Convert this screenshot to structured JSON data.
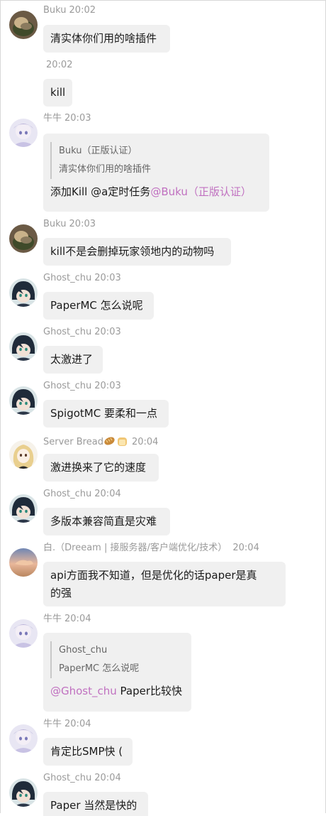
{
  "messages": [
    {
      "name": "Buku",
      "time": "20:02",
      "text": "清实体你们用的啥插件"
    },
    {
      "name": "",
      "time": "20:02",
      "text": "kill"
    },
    {
      "name": "牛牛",
      "time": "20:03",
      "quote_name": "Buku（正版认证）",
      "quote_text": "清实体你们用的啥插件",
      "text": "添加Kill @a定时任务",
      "mention": "@Buku（正版认证）"
    },
    {
      "name": "Buku",
      "time": "20:03",
      "text": "kill不是会删掉玩家领地内的动物吗"
    },
    {
      "name": "Ghost_chu",
      "time": "20:03",
      "text": "PaperMC 怎么说呢"
    },
    {
      "name": "Ghost_chu",
      "time": "20:03",
      "text": "太激进了"
    },
    {
      "name": "Ghost_chu",
      "time": "20:03",
      "text": "SpigotMC 要柔和一点"
    },
    {
      "name": "Server Bread",
      "time": "20:04",
      "text": "激进换来了它的速度",
      "emojis": [
        "bread-emoji",
        "bread-loaf-emoji"
      ]
    },
    {
      "name": "Ghost_chu",
      "time": "20:04",
      "text": "多版本兼容简直是灾难"
    },
    {
      "name": "白.（Dreeam | 接服务器/客户端优化/技术）",
      "time": "20:04",
      "text_line1": "api方面我不知道，但是优化的话paper是真",
      "text_line2": "的强"
    },
    {
      "name": "牛牛",
      "time": "20:04",
      "quote_name": "Ghost_chu",
      "quote_text": "PaperMC 怎么说呢",
      "mention": "@Ghost_chu",
      "text": " Paper比较快"
    },
    {
      "name": "牛牛",
      "time": "20:04",
      "text": "肯定比SMP快 ("
    },
    {
      "name": "Ghost_chu",
      "time": "20:04",
      "text": "Paper 当然是快的"
    }
  ],
  "colors": {
    "meta": "#9a9a9a",
    "bubble": "#f0f0f0",
    "mention": "#c070c0",
    "text": "#1a1a1a"
  }
}
